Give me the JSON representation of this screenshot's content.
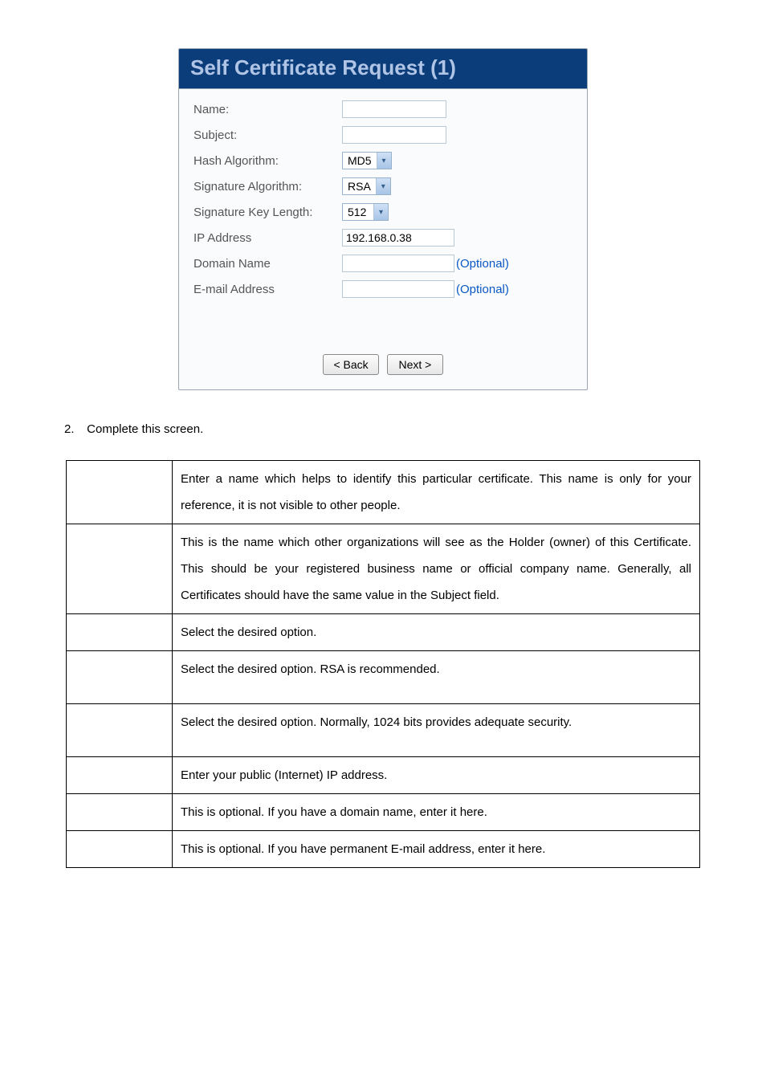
{
  "dialog": {
    "title": "Self Certificate Request (1)",
    "labels": {
      "name": "Name:",
      "subject": "Subject:",
      "hash": "Hash Algorithm:",
      "sig": "Signature Algorithm:",
      "keylen": "Signature Key Length:",
      "ip": "IP Address",
      "domain": "Domain Name",
      "email": "E-mail Address"
    },
    "values": {
      "hash": "MD5",
      "sig": "RSA",
      "keylen": "512",
      "ip": "192.168.0.38"
    },
    "optional": "(Optional)",
    "buttons": {
      "back": "< Back",
      "next": "Next >"
    }
  },
  "step": {
    "num": "2.",
    "text": "Complete this screen."
  },
  "table": {
    "rows": [
      "Enter a name which helps to identify this particular certificate. This name is only for your reference, it is not visible to other people.",
      "This is the name which other organizations will see as the Holder (owner) of this Certificate. This should be your registered business name or official company name.    Generally, all Certificates should have the same value in the Subject field.",
      "Select the desired option.",
      "Select the desired option. RSA is recommended.",
      "Select the desired option. Normally, 1024 bits provides adequate security.",
      "Enter your public (Internet) IP address.",
      "This is optional. If you have a domain name, enter it here.",
      "This is optional. If you have permanent E-mail address, enter it here."
    ]
  }
}
